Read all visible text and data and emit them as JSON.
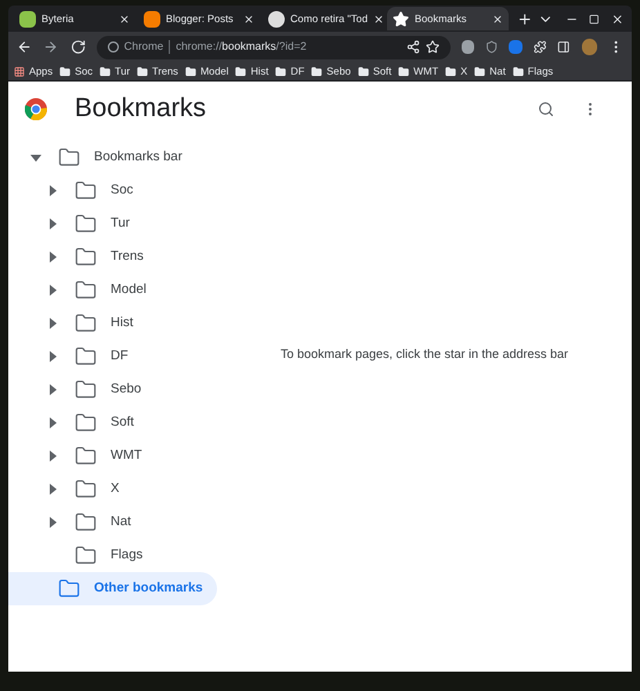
{
  "tabs": [
    {
      "title": "Byteria",
      "selected": false
    },
    {
      "title": "Blogger: Posts",
      "selected": false
    },
    {
      "title": "Como retira \"Tod",
      "selected": false
    },
    {
      "title": "Bookmarks",
      "selected": true
    }
  ],
  "address_bar": {
    "site": "Chrome",
    "url": "chrome://**bookmarks**/?id=2"
  },
  "bookmarks_bar": [
    "Apps",
    "Soc",
    "Tur",
    "Trens",
    "Model",
    "Hist",
    "DF",
    "Sebo",
    "Soft",
    "WMT",
    "X",
    "Nat",
    "Flags"
  ],
  "page": {
    "title": "Bookmarks",
    "empty_message": "To bookmark pages, click the star in the address bar"
  },
  "tree": [
    {
      "label": "Bookmarks bar",
      "expandable": true,
      "expanded": true,
      "selected": false,
      "children": [
        {
          "label": "Soc",
          "expandable": true,
          "expanded": false,
          "selected": false
        },
        {
          "label": "Tur",
          "expandable": true,
          "expanded": false,
          "selected": false
        },
        {
          "label": "Trens",
          "expandable": true,
          "expanded": false,
          "selected": false
        },
        {
          "label": "Model",
          "expandable": true,
          "expanded": false,
          "selected": false
        },
        {
          "label": "Hist",
          "expandable": true,
          "expanded": false,
          "selected": false
        },
        {
          "label": "DF",
          "expandable": true,
          "expanded": false,
          "selected": false
        },
        {
          "label": "Sebo",
          "expandable": true,
          "expanded": false,
          "selected": false
        },
        {
          "label": "Soft",
          "expandable": true,
          "expanded": false,
          "selected": false
        },
        {
          "label": "WMT",
          "expandable": true,
          "expanded": false,
          "selected": false
        },
        {
          "label": "X",
          "expandable": true,
          "expanded": false,
          "selected": false
        },
        {
          "label": "Nat",
          "expandable": true,
          "expanded": false,
          "selected": false
        },
        {
          "label": "Flags",
          "expandable": false,
          "expanded": false,
          "selected": false
        }
      ]
    },
    {
      "label": "Other bookmarks",
      "expandable": false,
      "expanded": false,
      "selected": true
    }
  ]
}
